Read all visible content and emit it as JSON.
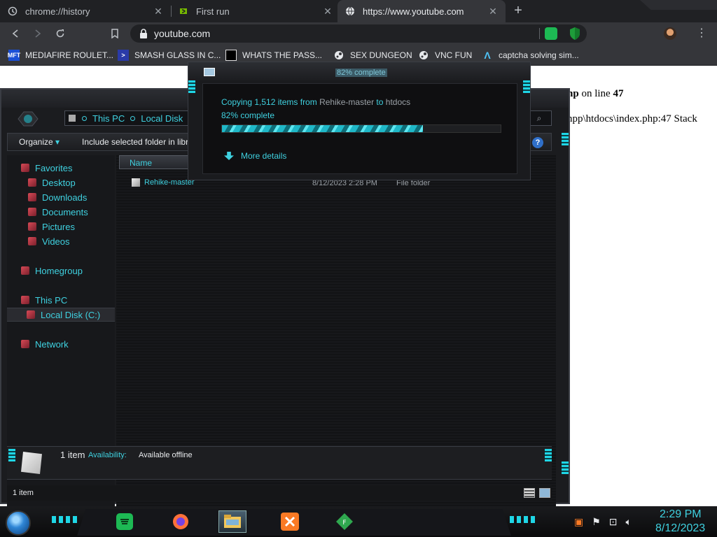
{
  "browser": {
    "tabs": [
      {
        "title": "chrome://history",
        "icon": "history-icon",
        "active": false
      },
      {
        "title": "First run",
        "icon": "nvidia-icon",
        "active": false
      },
      {
        "title": "https://www.youtube.com",
        "icon": "globe-icon",
        "active": true
      }
    ],
    "close_glyph": "✕",
    "new_tab_glyph": "+",
    "url": "youtube.com",
    "bookmarks": [
      {
        "label": "MEDIAFIRE ROULET...",
        "icon": "mft-icon",
        "icon_text": "MFT"
      },
      {
        "label": "SMASH GLASS IN C...",
        "icon": "powershell-icon",
        "icon_text": ">"
      },
      {
        "label": "WHATS THE PASS...",
        "icon": "lock-bookmark-icon",
        "icon_text": ""
      },
      {
        "label": "SEX DUNGEON",
        "icon": "steam-icon",
        "icon_text": ""
      },
      {
        "label": "VNC FUN",
        "icon": "steam-icon",
        "icon_text": ""
      },
      {
        "label": "captcha solving sim...",
        "icon": "a-logo-icon",
        "icon_text": "Λ"
      }
    ]
  },
  "page": {
    "line1_pre": "hp",
    "line1_mid": " on line ",
    "line1_num": "47",
    "line2": "npp\\htdocs\\index.php:47 Stack"
  },
  "explorer": {
    "breadcrumb": [
      "This PC",
      "Local Disk"
    ],
    "toolbar": {
      "organize": "Organize",
      "organize_arrow": "▾",
      "include": "Include selected folder in libr"
    },
    "help": "?",
    "nav": {
      "favorites": "Favorites",
      "desktop": "Desktop",
      "downloads": "Downloads",
      "documents": "Documents",
      "pictures": "Pictures",
      "videos": "Videos",
      "homegroup": "Homegroup",
      "this_pc": "This PC",
      "local_disk": "Local Disk (C:)",
      "network": "Network"
    },
    "column_name": "Name",
    "rows": [
      {
        "name": "Rehike-master",
        "date": "8/12/2023 2:28 PM",
        "type": "File folder"
      }
    ],
    "details": {
      "count": "1 item",
      "availability_label": "Availability:",
      "availability_value": "Available offline"
    },
    "status": "1 item"
  },
  "copy_dialog": {
    "title": "82% complete",
    "copying": "Copying 1,512 items from ",
    "source": "Rehike-master",
    "to": " to ",
    "dest": "htdocs",
    "percent_text": "82% complete",
    "progress": 0.72,
    "more_details": "More details"
  },
  "taskbar": {
    "time": "2:29 PM",
    "date": "8/12/2023",
    "apps": [
      "spotify-icon",
      "firefox-icon",
      "file-explorer-icon",
      "xampp-icon",
      "fenix-icon"
    ]
  },
  "colors": {
    "accent": "#3fd1e0",
    "chrome_dark": "#202124",
    "chrome_toolbar": "#35363a"
  }
}
